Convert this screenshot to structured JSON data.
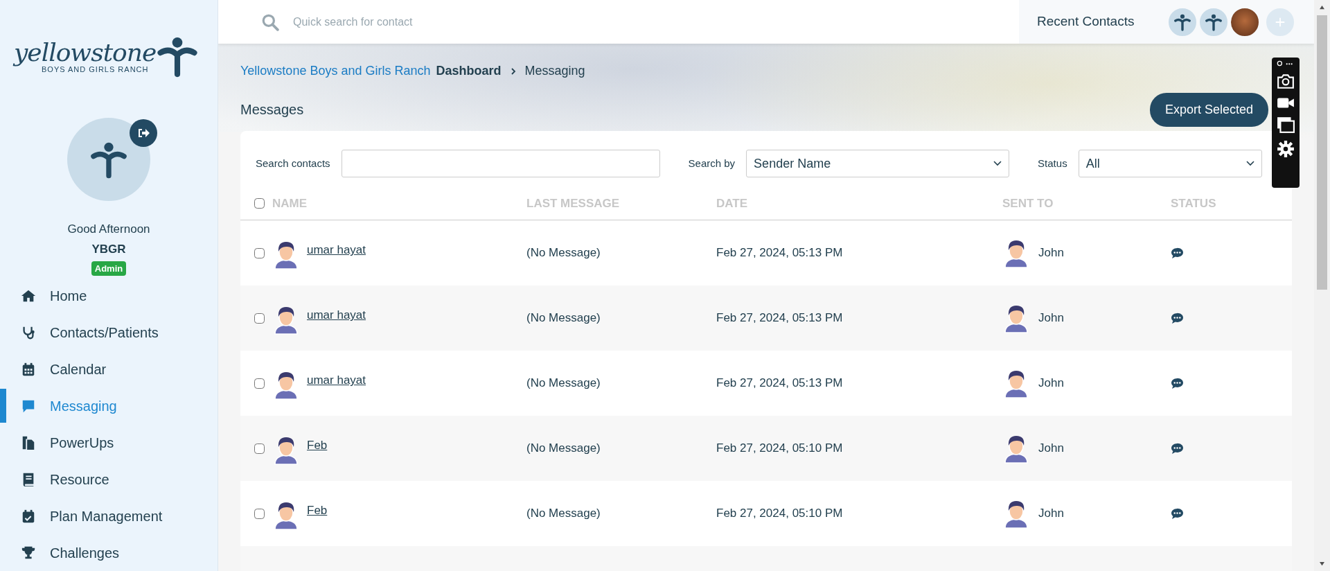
{
  "sidebar": {
    "logo": {
      "wordmark": "yellowstone",
      "tagline": "BOYS AND GIRLS RANCH"
    },
    "greeting": "Good Afternoon",
    "user": "YBGR",
    "role": "Admin",
    "items": [
      {
        "label": "Home",
        "selected": false
      },
      {
        "label": "Contacts/Patients",
        "selected": false
      },
      {
        "label": "Calendar",
        "selected": false
      },
      {
        "label": "Messaging",
        "selected": true
      },
      {
        "label": "PowerUps",
        "selected": false
      },
      {
        "label": "Resource",
        "selected": false
      },
      {
        "label": "Plan Management",
        "selected": false
      },
      {
        "label": "Challenges",
        "selected": false
      }
    ]
  },
  "topbar": {
    "search_placeholder": "Quick search for contact",
    "recent_label": "Recent Contacts",
    "recent": [
      {
        "kind": "logo"
      },
      {
        "kind": "logo"
      },
      {
        "kind": "photo"
      },
      {
        "kind": "add"
      }
    ]
  },
  "breadcrumb": {
    "org": "Yellowstone Boys and Girls Ranch",
    "page": "Dashboard",
    "current": "Messaging"
  },
  "title": "Messages",
  "export_button": "Export Selected",
  "filters": {
    "search_label": "Search contacts",
    "search_by_label": "Search by",
    "search_by_value": "Sender Name",
    "status_label": "Status",
    "status_value": "All"
  },
  "table": {
    "columns": [
      "NAME",
      "LAST MESSAGE",
      "DATE",
      "SENT TO",
      "STATUS"
    ],
    "select_all_checked": false,
    "rows": [
      {
        "name": "umar hayat",
        "last_message": "(No Message)",
        "date": "Feb 27, 2024, 05:13 PM",
        "sent_to": "John",
        "checked": false
      },
      {
        "name": "umar hayat",
        "last_message": "(No Message)",
        "date": "Feb 27, 2024, 05:13 PM",
        "sent_to": "John",
        "checked": false
      },
      {
        "name": "umar hayat",
        "last_message": "(No Message)",
        "date": "Feb 27, 2024, 05:13 PM",
        "sent_to": "John",
        "checked": false
      },
      {
        "name": "Feb",
        "last_message": "(No Message)",
        "date": "Feb 27, 2024, 05:10 PM",
        "sent_to": "John",
        "checked": false
      },
      {
        "name": "Feb",
        "last_message": "(No Message)",
        "date": "Feb 27, 2024, 05:10 PM",
        "sent_to": "John",
        "checked": false
      }
    ]
  }
}
